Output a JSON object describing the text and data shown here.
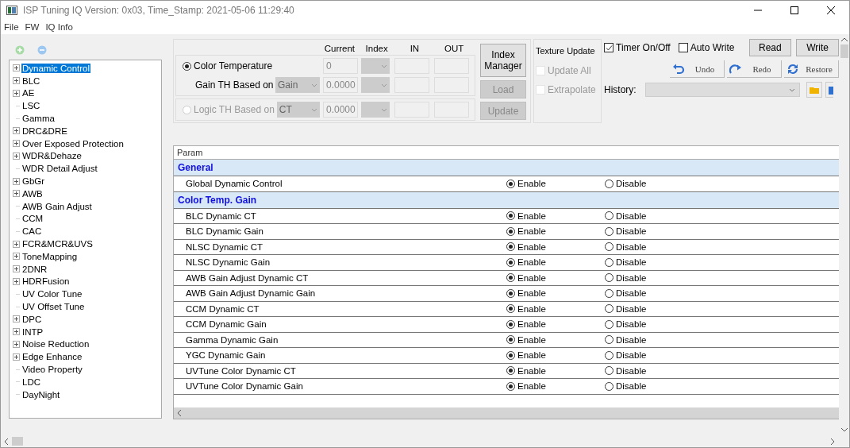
{
  "window": {
    "title": "ISP Tuning IQ Version: 0x03, Time_Stamp: 2021-05-06 11:29:40"
  },
  "menu": [
    "File",
    "FW",
    "IQ Info"
  ],
  "tree": [
    {
      "label": "Dynamic Control",
      "kind": "node",
      "selected": true
    },
    {
      "label": "BLC",
      "kind": "node",
      "selected": false
    },
    {
      "label": "AE",
      "kind": "node",
      "selected": false
    },
    {
      "label": "LSC",
      "kind": "leaf",
      "selected": false
    },
    {
      "label": "Gamma",
      "kind": "leaf",
      "selected": false
    },
    {
      "label": "DRC&DRE",
      "kind": "node",
      "selected": false
    },
    {
      "label": "Over Exposed Protection",
      "kind": "node",
      "selected": false
    },
    {
      "label": "WDR&Dehaze",
      "kind": "node",
      "selected": false
    },
    {
      "label": "WDR Detail Adjust",
      "kind": "leaf",
      "selected": false
    },
    {
      "label": "GbGr",
      "kind": "node",
      "selected": false
    },
    {
      "label": "AWB",
      "kind": "node",
      "selected": false
    },
    {
      "label": "AWB Gain Adjust",
      "kind": "leaf",
      "selected": false
    },
    {
      "label": "CCM",
      "kind": "leaf",
      "selected": false
    },
    {
      "label": "CAC",
      "kind": "leaf",
      "selected": false
    },
    {
      "label": "FCR&MCR&UVS",
      "kind": "node",
      "selected": false
    },
    {
      "label": "ToneMapping",
      "kind": "node",
      "selected": false
    },
    {
      "label": "2DNR",
      "kind": "node",
      "selected": false
    },
    {
      "label": "HDRFusion",
      "kind": "node",
      "selected": false
    },
    {
      "label": "UV Color Tune",
      "kind": "leaf",
      "selected": false
    },
    {
      "label": "UV Offset Tune",
      "kind": "leaf",
      "selected": false
    },
    {
      "label": "DPC",
      "kind": "node",
      "selected": false
    },
    {
      "label": "INTP",
      "kind": "node",
      "selected": false
    },
    {
      "label": "Noise Reduction",
      "kind": "node",
      "selected": false
    },
    {
      "label": "Edge Enhance",
      "kind": "node",
      "selected": false
    },
    {
      "label": "Video Property",
      "kind": "leaf",
      "selected": false
    },
    {
      "label": "LDC",
      "kind": "leaf",
      "selected": false
    },
    {
      "label": "DayNight",
      "kind": "leaf",
      "selected": false
    }
  ],
  "threshold": {
    "columns": [
      "Current",
      "Index",
      "IN",
      "OUT"
    ],
    "rows": [
      {
        "kind": "radio",
        "label": "Color Temperature",
        "selected": true,
        "current": "0"
      },
      {
        "kind": "select",
        "label": "Gain TH Based on",
        "select": "Gain",
        "current": "0.0000"
      },
      {
        "kind": "radioselect",
        "label": "Logic TH Based on",
        "selected": false,
        "disabled": true,
        "select": "CT",
        "current": "0.0000"
      }
    ],
    "buttons": [
      {
        "label": "Index Manager",
        "disabled": false
      },
      {
        "label": "Load",
        "disabled": true
      },
      {
        "label": "Update",
        "disabled": true
      }
    ]
  },
  "texture": {
    "title": "Texture Update",
    "checks": [
      {
        "label": "Update All",
        "checked": false,
        "disabled": true
      },
      {
        "label": "Extrapolate",
        "checked": false,
        "disabled": true
      }
    ]
  },
  "toolbar": {
    "checks": [
      {
        "label": "Timer On/Off",
        "checked": true
      },
      {
        "label": "Auto Write",
        "checked": false
      }
    ],
    "buttons": [
      "Read",
      "Write"
    ],
    "history_buttons": [
      {
        "label": "Undo",
        "kind": "undo"
      },
      {
        "label": "Redo",
        "kind": "redo"
      },
      {
        "label": "Restore",
        "kind": "restore"
      }
    ],
    "history_label": "History:"
  },
  "grid": {
    "header": "Param",
    "sections": [
      {
        "title": "General",
        "rows": [
          {
            "name": "Global Dynamic Control",
            "options": [
              {
                "label": "Enable",
                "selected": true
              },
              {
                "label": "Disable",
                "selected": false
              }
            ]
          }
        ]
      },
      {
        "title": "Color Temp.  Gain",
        "rows": [
          {
            "name": "BLC Dynamic CT",
            "options": [
              {
                "label": "Enable",
                "selected": true
              },
              {
                "label": "Disable",
                "selected": false
              }
            ]
          },
          {
            "name": "BLC Dynamic Gain",
            "options": [
              {
                "label": "Enable",
                "selected": true
              },
              {
                "label": "Disable",
                "selected": false
              }
            ]
          },
          {
            "name": "NLSC Dynamic CT",
            "options": [
              {
                "label": "Enable",
                "selected": true
              },
              {
                "label": "Disable",
                "selected": false
              }
            ]
          },
          {
            "name": "NLSC Dynamic Gain",
            "options": [
              {
                "label": "Enable",
                "selected": true
              },
              {
                "label": "Disable",
                "selected": false
              }
            ]
          },
          {
            "name": "AWB Gain Adjust Dynamic CT",
            "options": [
              {
                "label": "Enable",
                "selected": true
              },
              {
                "label": "Disable",
                "selected": false
              }
            ]
          },
          {
            "name": "AWB Gain Adjust Dynamic Gain",
            "options": [
              {
                "label": "Enable",
                "selected": true
              },
              {
                "label": "Disable",
                "selected": false
              }
            ]
          },
          {
            "name": "CCM Dynamic CT",
            "options": [
              {
                "label": "Enable",
                "selected": true
              },
              {
                "label": "Disable",
                "selected": false
              }
            ]
          },
          {
            "name": "CCM Dynamic Gain",
            "options": [
              {
                "label": "Enable",
                "selected": true
              },
              {
                "label": "Disable",
                "selected": false
              }
            ]
          },
          {
            "name": "Gamma Dynamic Gain",
            "options": [
              {
                "label": "Enable",
                "selected": true
              },
              {
                "label": "Disable",
                "selected": false
              }
            ]
          },
          {
            "name": "YGC Dynamic Gain",
            "options": [
              {
                "label": "Enable",
                "selected": true
              },
              {
                "label": "Disable",
                "selected": false
              }
            ]
          },
          {
            "name": "UVTune Color Dynamic CT",
            "options": [
              {
                "label": "Enable",
                "selected": true
              },
              {
                "label": "Disable",
                "selected": false
              }
            ]
          },
          {
            "name": "UVTune Color Dynamic Gain",
            "options": [
              {
                "label": "Enable",
                "selected": true
              },
              {
                "label": "Disable",
                "selected": false
              }
            ]
          }
        ]
      }
    ]
  }
}
